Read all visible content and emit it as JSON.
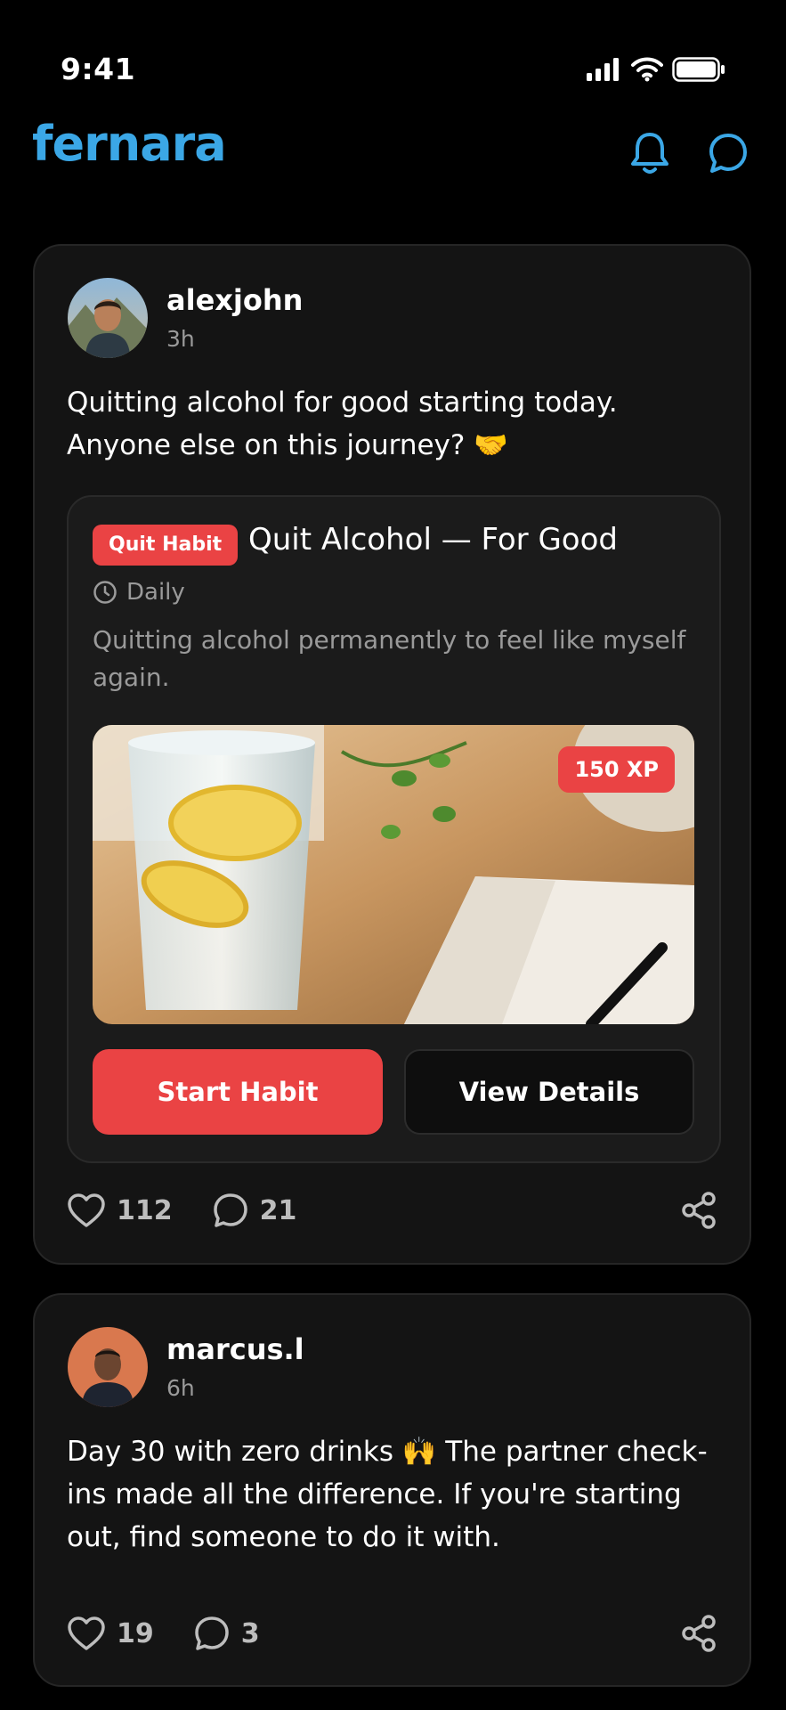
{
  "status_bar": {
    "time": "9:41"
  },
  "app": {
    "logo": "fernara",
    "accent": "#3ba7e6"
  },
  "header_icons": [
    "bell-icon",
    "chat-bubble-icon"
  ],
  "posts": [
    {
      "username": "alexjohn",
      "time_ago": "3h",
      "text": "Quitting alcohol for good starting today. Anyone else on this journey? 🤝",
      "habit_card": {
        "tag": "Quit Habit",
        "title": "Quit Alcohol — For Good",
        "frequency": "Daily",
        "description": "Quitting alcohol permanently to feel like myself again.",
        "xp_badge": "150 XP",
        "primary_button": "Start Habit",
        "secondary_button": "View Details"
      },
      "likes": "112",
      "comments": "21"
    },
    {
      "username": "marcus.l",
      "time_ago": "6h",
      "text": "Day 30 with zero drinks 🙌  The partner check-ins made all the difference. If you're starting out, find someone to do it with.",
      "likes": "19",
      "comments": "3"
    }
  ],
  "colors": {
    "accent_red": "#ea4344",
    "card_bg": "#141414"
  }
}
